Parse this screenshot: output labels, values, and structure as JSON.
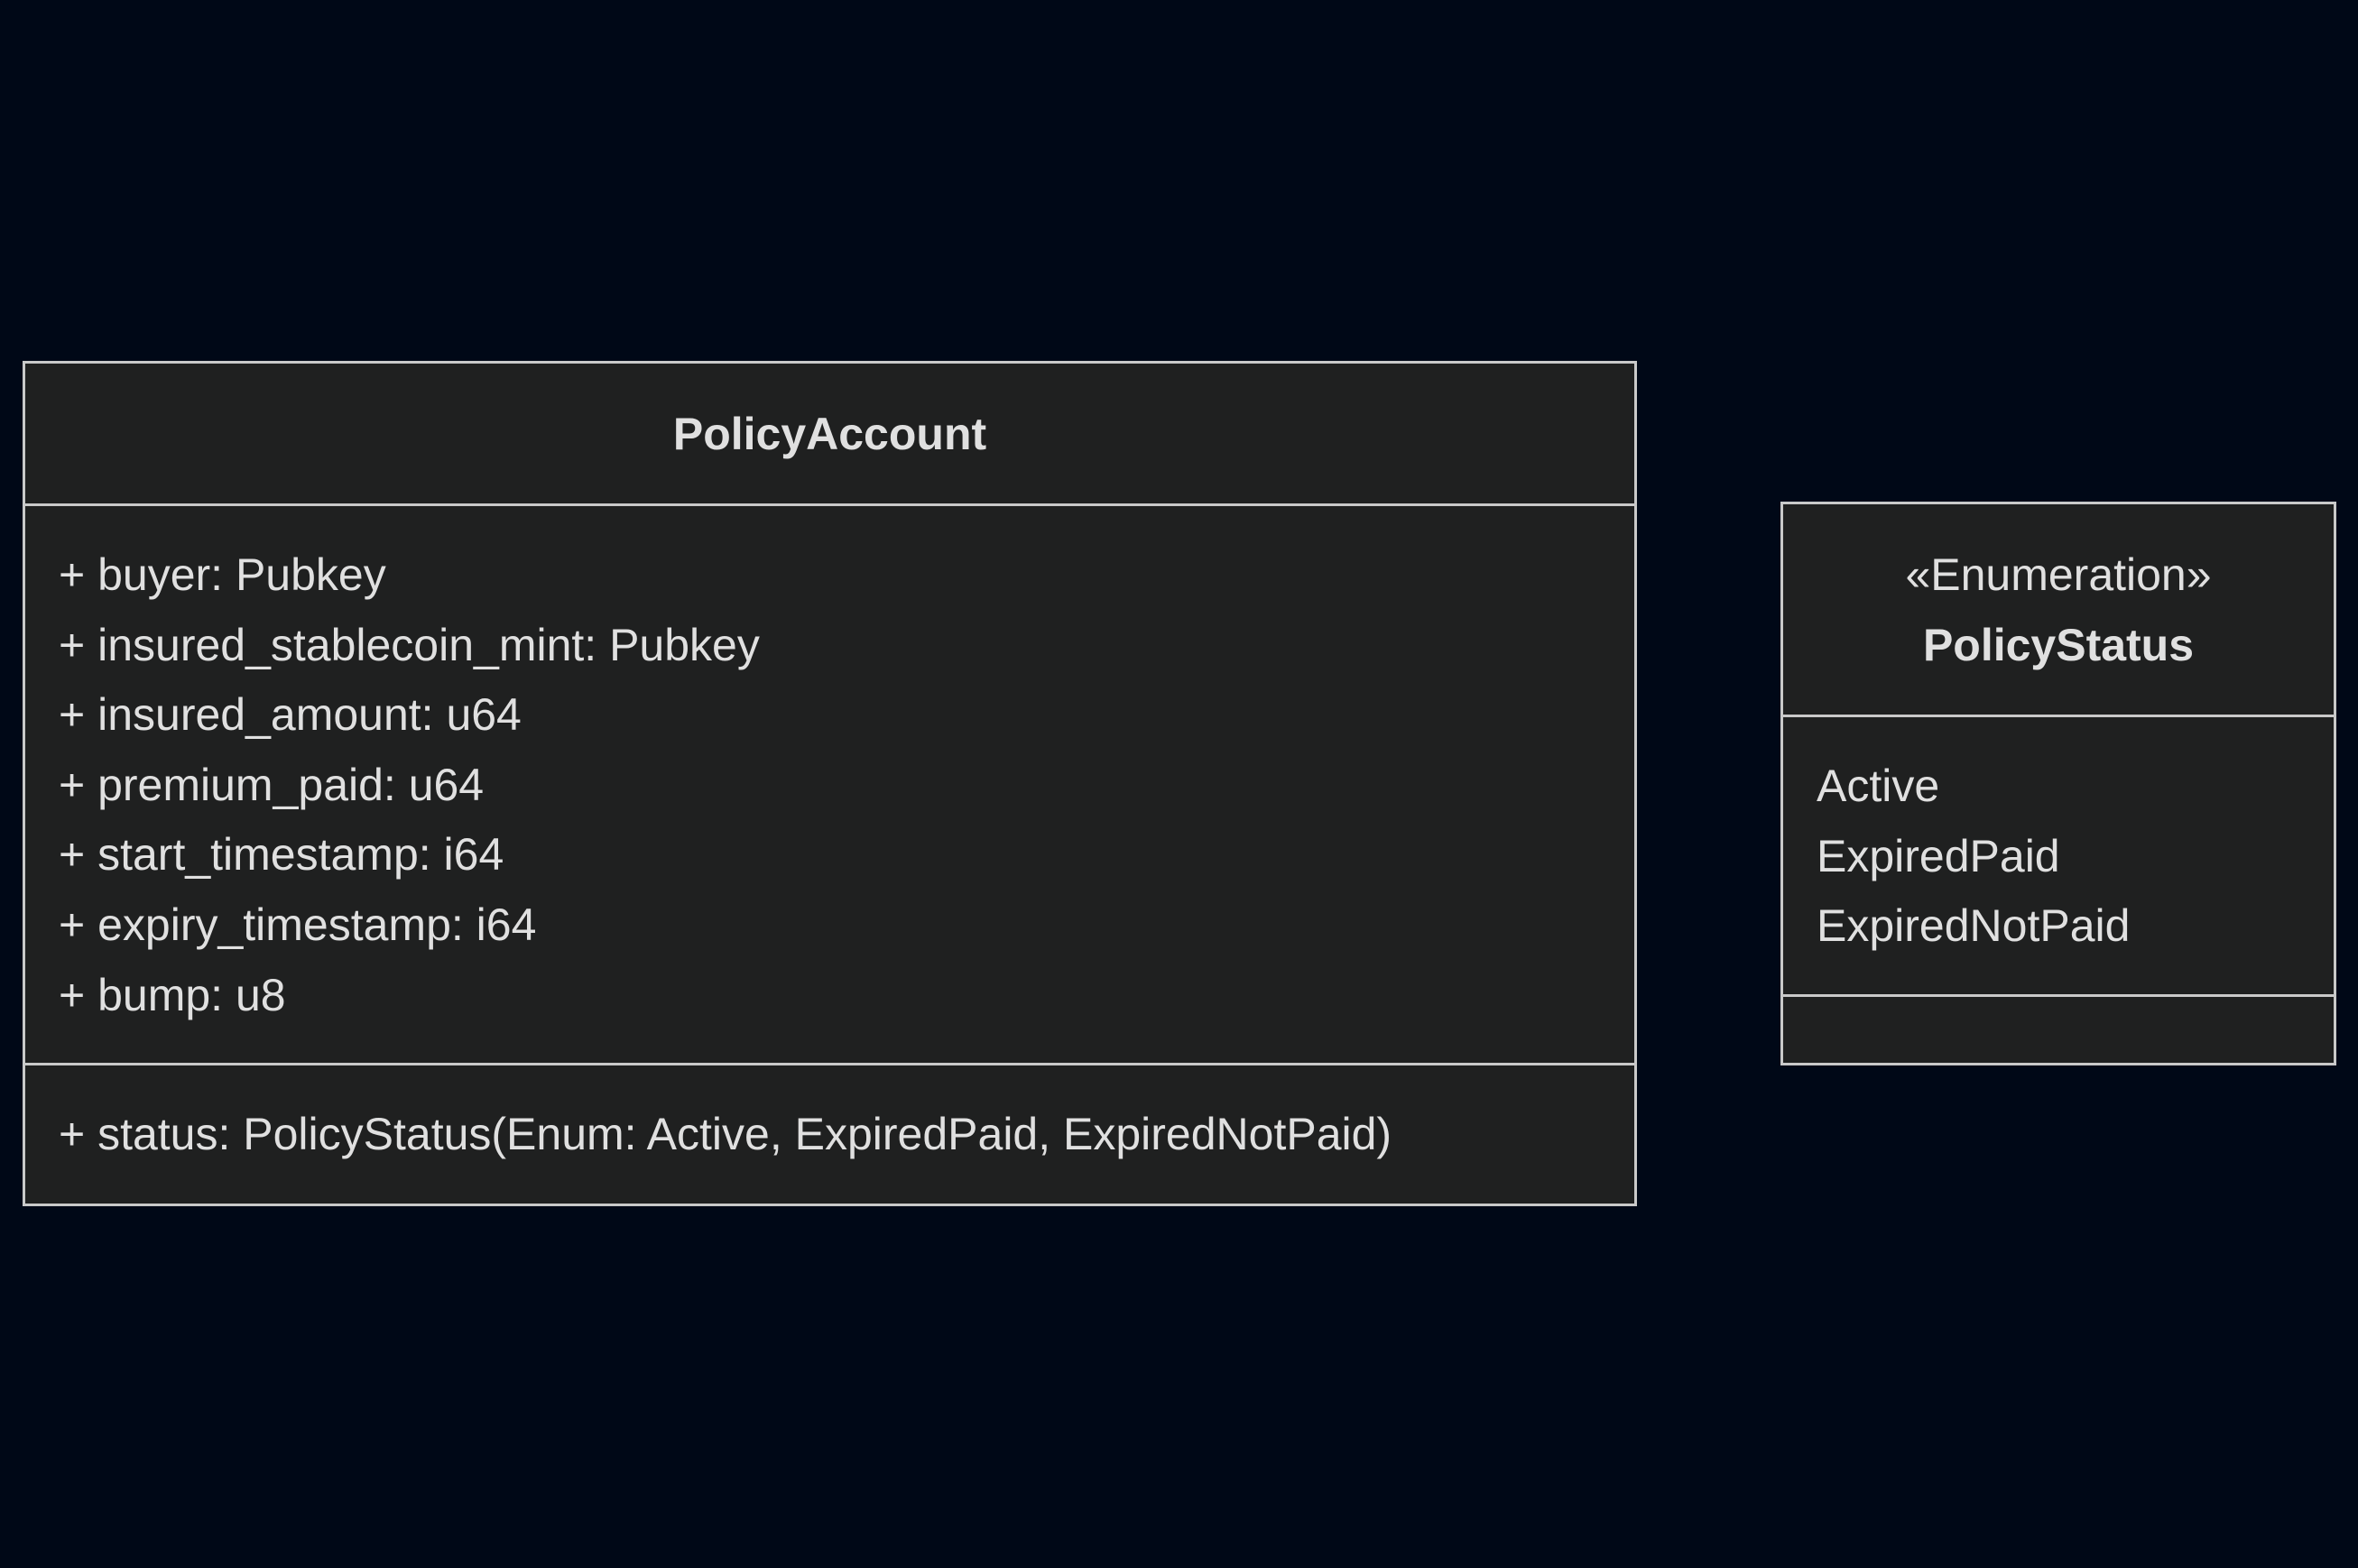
{
  "colors": {
    "background": "#000817",
    "box_fill": "#1f2020",
    "box_border": "#c9c9c9",
    "text": "#e0e0e0"
  },
  "classes": [
    {
      "name": "PolicyAccount",
      "stereotype": "",
      "attributes": [
        "+ buyer: Pubkey",
        "+ insured_stablecoin_mint: Pubkey",
        "+ insured_amount: u64",
        "+ premium_paid: u64",
        "+ start_timestamp: i64",
        "+ expiry_timestamp: i64",
        "+ bump: u8"
      ],
      "operations": [
        "+ status: PolicyStatus(Enum: Active, ExpiredPaid, ExpiredNotPaid)"
      ]
    },
    {
      "name": "PolicyStatus",
      "stereotype": "«Enumeration»",
      "literals": [
        "Active",
        "ExpiredPaid",
        "ExpiredNotPaid"
      ],
      "operations": []
    }
  ]
}
